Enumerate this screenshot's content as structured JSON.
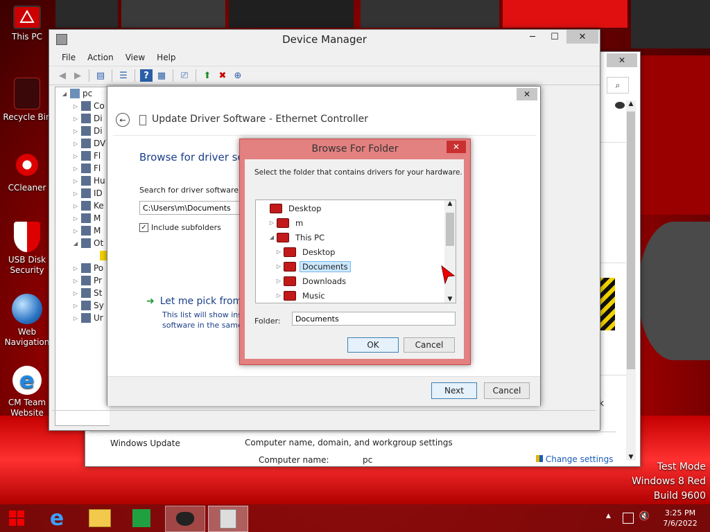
{
  "desktop": {
    "icons": [
      {
        "label": "This PC"
      },
      {
        "label": "Recycle Bin"
      },
      {
        "label": "CCleaner"
      },
      {
        "label": "USB Disk Security"
      },
      {
        "label": "Web Navigation"
      },
      {
        "label": "CM Team Website"
      }
    ],
    "watermark": {
      "line1": "Test Mode",
      "line2": "Windows 8 Red",
      "line3": "Build 9600"
    }
  },
  "device_manager": {
    "title": "Device Manager",
    "menu": [
      "File",
      "Action",
      "View",
      "Help"
    ],
    "tree_root": "pc",
    "tree_items": [
      "Co",
      "Di",
      "Di",
      "DV",
      "Fl",
      "Fl",
      "Hu",
      "ID",
      "Ke",
      "M",
      "M",
      "Ot",
      "",
      "Po",
      "Pr",
      "St",
      "Sy",
      "Ur"
    ]
  },
  "background_window": {
    "windows_update": "Windows Update",
    "computer_settings": "Computer name, domain, and workgroup settings",
    "computer_name_label": "Computer name:",
    "computer_name_value": "pc",
    "change_settings": "Change settings",
    "partial_k": "k"
  },
  "update_driver": {
    "title": "Update Driver Software - Ethernet Controller",
    "heading": "Browse for driver sof",
    "search_label": "Search for driver software ir",
    "path_value": "C:\\Users\\m\\Documents",
    "include_subfolders": "Include subfolders",
    "include_checked": true,
    "pick_title": "Let me pick from",
    "pick_desc_line1": "This list will show inst",
    "pick_desc_line2": "software in the same",
    "next_label": "Next",
    "cancel_label": "Cancel"
  },
  "browse_dialog": {
    "title": "Browse For Folder",
    "instruction": "Select the folder that contains drivers for your hardware.",
    "folders": [
      {
        "label": "Desktop",
        "indent": 0,
        "expander": "",
        "selected": false
      },
      {
        "label": "m",
        "indent": 1,
        "expander": "▷",
        "selected": false
      },
      {
        "label": "This PC",
        "indent": 1,
        "expander": "◢",
        "selected": false
      },
      {
        "label": "Desktop",
        "indent": 2,
        "expander": "▷",
        "selected": false
      },
      {
        "label": "Documents",
        "indent": 2,
        "expander": "▷",
        "selected": true
      },
      {
        "label": "Downloads",
        "indent": 2,
        "expander": "▷",
        "selected": false
      },
      {
        "label": "Music",
        "indent": 2,
        "expander": "▷",
        "selected": false
      }
    ],
    "folder_label": "Folder:",
    "folder_value": "Documents",
    "ok_label": "OK",
    "cancel_label": "Cancel"
  },
  "taskbar": {
    "time": "3:25 PM",
    "date": "7/6/2022"
  },
  "colors": {
    "accent_red": "#d40000",
    "dialog_border": "#e07a7a",
    "selection": "#cce8ff"
  }
}
